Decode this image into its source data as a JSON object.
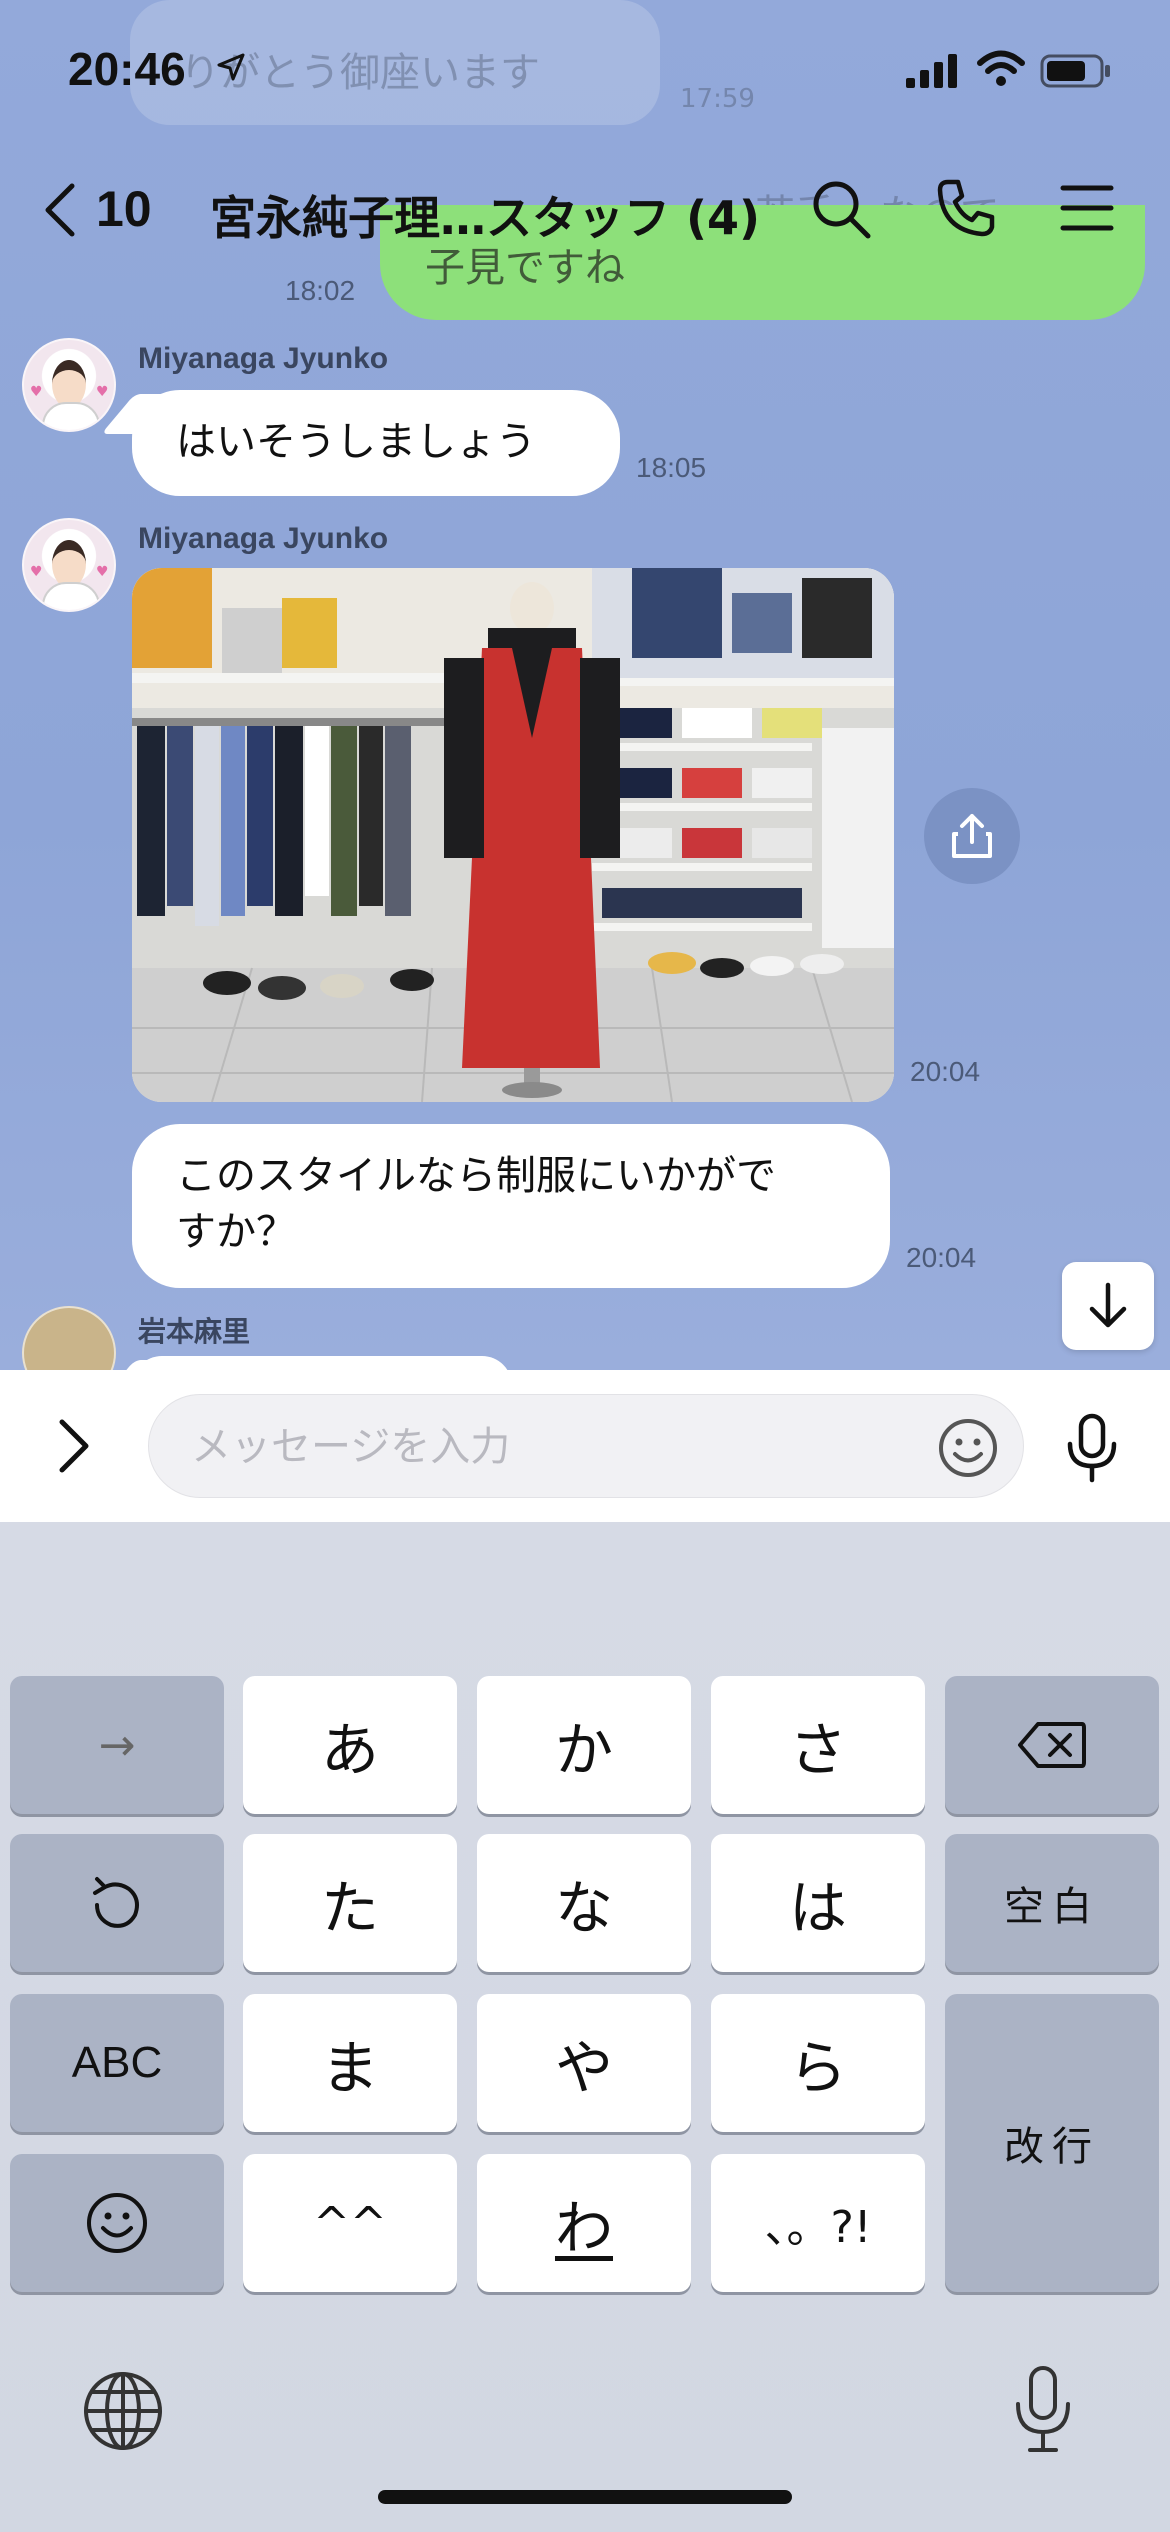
{
  "status_bar": {
    "time": "20:46"
  },
  "nav": {
    "back_count": "10",
    "title": "宮永純子理…スタッフ (4)"
  },
  "background_messages": {
    "faded_line_1": "りがとう御座います",
    "faded_time_1": "17:59",
    "faded_line_2": "若手",
    "faded_line_2b": "なので",
    "faded_line_3": "子見ですね",
    "green_time": "18:02"
  },
  "messages": [
    {
      "sender": "Miyanaga  Jyunko",
      "text": "はいそうしましょう",
      "time": "18:05"
    },
    {
      "sender": "Miyanaga  Jyunko",
      "image": "mannequin-red-dress-photo",
      "time": "20:04"
    },
    {
      "text_line_1": "このスタイルなら制服にいかがで",
      "text_line_2": "すか？",
      "time": "20:04"
    },
    {
      "sender": "岩本麻里"
    }
  ],
  "input": {
    "placeholder": "メッセージを入力"
  },
  "keyboard": {
    "row1": [
      "→",
      "あ",
      "か",
      "さ",
      "⌫"
    ],
    "row2": [
      "↺",
      "た",
      "な",
      "は",
      "空白"
    ],
    "row3": [
      "ABC",
      "ま",
      "や",
      "ら",
      "改行"
    ],
    "row4": [
      "☺",
      "^^",
      "わ",
      "、。?!"
    ]
  },
  "colors": {
    "chat_bg": "#8fa8d8",
    "own_bubble": "#8de07a",
    "bubble": "#ffffff",
    "caret": "#3478f6"
  }
}
